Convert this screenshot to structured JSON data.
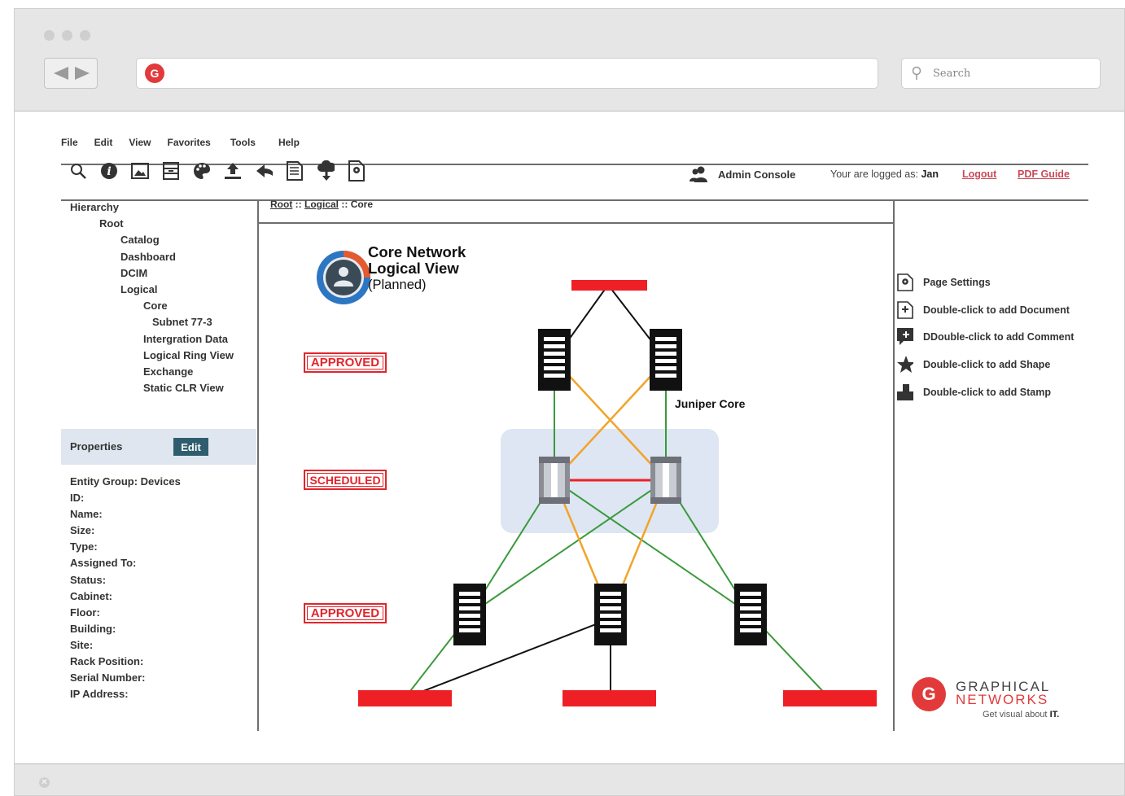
{
  "browser": {
    "search_placeholder": "Search",
    "url_logo": "G"
  },
  "menu": [
    "File",
    "Edit",
    "View",
    "Favorites",
    "Tools",
    "Help"
  ],
  "toolbar_icons": [
    "search-icon",
    "info-icon",
    "image-icon",
    "archive-icon",
    "palette-icon",
    "upload-icon",
    "reply-icon",
    "document-icon",
    "cloud-download-icon",
    "settings-page-icon"
  ],
  "header": {
    "admin_console": "Admin Console",
    "logged_prefix": "Your are logged as:",
    "user": "Jan",
    "logout": "Logout",
    "pdf_guide": "PDF Guide"
  },
  "hierarchy": {
    "title": "Hierarchy",
    "items": [
      {
        "label": "Root",
        "level": 1
      },
      {
        "label": "Catalog",
        "level": 2
      },
      {
        "label": "Dashboard",
        "level": 2
      },
      {
        "label": "DCIM",
        "level": 2
      },
      {
        "label": "Logical",
        "level": 2
      },
      {
        "label": "Core",
        "level": 3
      },
      {
        "label": "Subnet 77-3",
        "level": 4
      },
      {
        "label": "Intergration Data",
        "level": 3
      },
      {
        "label": "Logical Ring View",
        "level": 3
      },
      {
        "label": "Exchange",
        "level": 3
      },
      {
        "label": "Static CLR View",
        "level": 3
      }
    ]
  },
  "properties": {
    "title": "Properties",
    "edit_label": "Edit",
    "fields": [
      "Entity Group: Devices",
      "ID:",
      "Name:",
      "Size:",
      "Type:",
      "Assigned To:",
      "Status:",
      "Cabinet:",
      "Floor:",
      "Building:",
      "Site:",
      "Rack Position:",
      "Serial Number:",
      "IP Address:"
    ]
  },
  "breadcrumb": {
    "root": "Root",
    "sep1": " :: ",
    "logical": "Logical",
    "sep2": " :: ",
    "current": "Core"
  },
  "diagram": {
    "title_line1": "Core Network",
    "title_line2": "Logical View",
    "subtitle": "(Planned)",
    "stamps": [
      "APPROVED",
      "SCHEDULED",
      "APPROVED"
    ],
    "group_label": "Juniper Core",
    "colors": {
      "red": "#ee2026",
      "green": "#3a9a3a",
      "orange": "#f2a32a",
      "black": "#111111",
      "group_fill": "#dde6f2"
    }
  },
  "right_panel": [
    {
      "icon": "page-settings-icon",
      "label": "Page Settings"
    },
    {
      "icon": "add-document-icon",
      "label": "Double-click to add Document"
    },
    {
      "icon": "add-comment-icon",
      "label": "DDouble-click to add Comment"
    },
    {
      "icon": "star-icon",
      "label": "Double-click to add Shape"
    },
    {
      "icon": "stamp-icon",
      "label": "Double-click to add Stamp"
    }
  ],
  "brand": {
    "mark": "G",
    "line1": "GRAPHICAL",
    "line2": "NETWORKS",
    "tagline": "Get visual about",
    "tagline_bold": "IT."
  }
}
